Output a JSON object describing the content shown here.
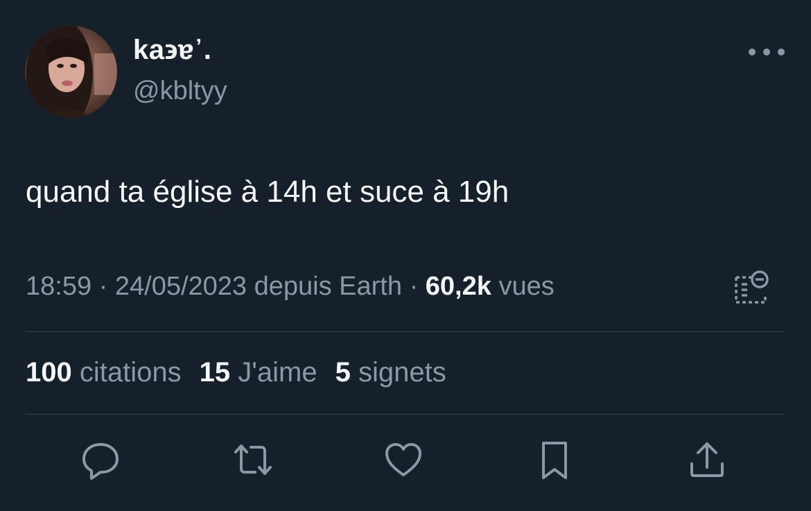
{
  "author": {
    "display_name": "ka϶ɐ᾿.",
    "handle": "@kbltyy",
    "avatar_icon": "profile-photo"
  },
  "more_icon": "more-horizontal-icon",
  "tweet": {
    "text": "quand ta église à 14h et suce à 19h"
  },
  "meta": {
    "time": "18:59",
    "separator": "·",
    "date": "24/05/2023",
    "source": "depuis Earth",
    "views_count": "60,2k",
    "views_label": "vues"
  },
  "stats": {
    "quotes": {
      "count": "100",
      "label": "citations"
    },
    "likes": {
      "count": "15",
      "label": "J'aime"
    },
    "bookmarks": {
      "count": "5",
      "label": "signets"
    }
  },
  "actions": [
    "reply-icon",
    "retweet-icon",
    "like-icon",
    "bookmark-icon",
    "share-icon"
  ],
  "colors": {
    "background": "#15202b",
    "primary_text": "#f7f9f9",
    "secondary_text": "#8b98a5",
    "divider": "#38444d"
  }
}
